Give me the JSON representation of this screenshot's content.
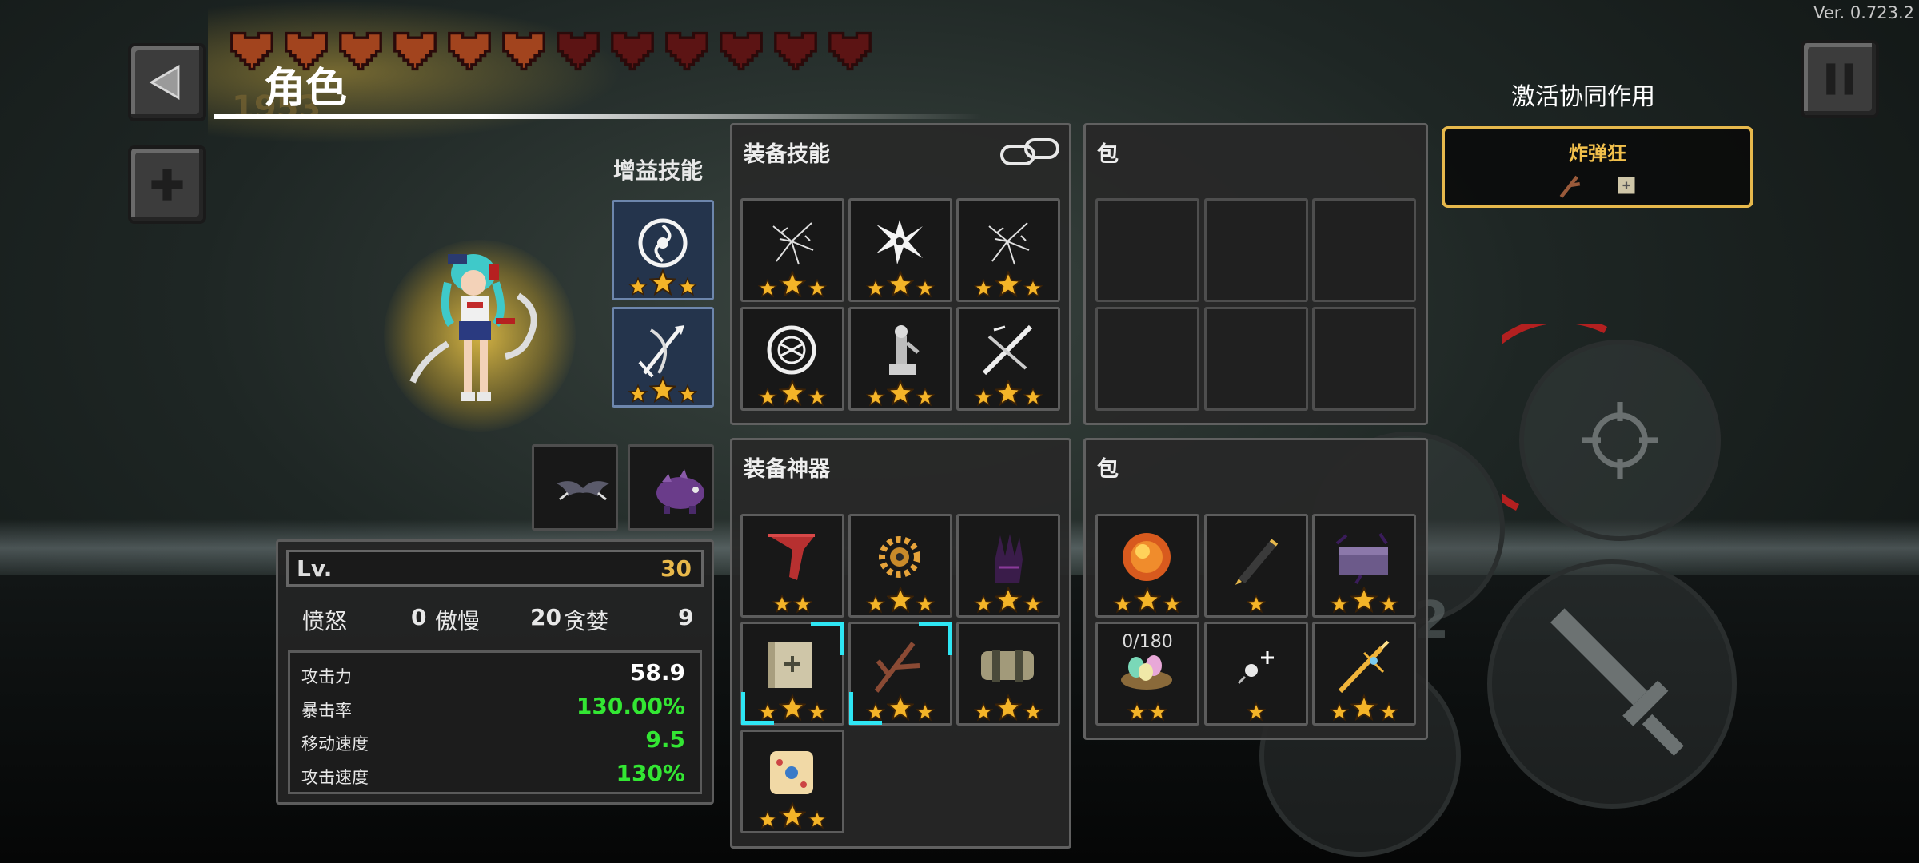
{
  "version": "Ver. 0.723.2",
  "title": "角色",
  "gold": "1953",
  "hearts": {
    "count": 12,
    "icon": "heart-icon"
  },
  "buff_skills": {
    "label": "增益技能",
    "items": [
      {
        "icon": "swirl-orb-icon",
        "stars": 3
      },
      {
        "icon": "bow-arrow-icon",
        "stars": 3
      }
    ]
  },
  "character": {
    "icon": "character-sprite-icon"
  },
  "companions": [
    {
      "icon": "bat-icon"
    },
    {
      "icon": "purple-boar-icon"
    }
  ],
  "equipped_skills": {
    "label": "装备技能",
    "link_icon": "chain-link-icon",
    "items": [
      {
        "icon": "shatter-icon",
        "stars": 3
      },
      {
        "icon": "shuriken-icon",
        "stars": 3
      },
      {
        "icon": "shatter-icon",
        "stars": 3
      },
      {
        "icon": "spiral-ring-icon",
        "stars": 3
      },
      {
        "icon": "statue-icon",
        "stars": 3
      },
      {
        "icon": "crossed-blades-icon",
        "stars": 3
      }
    ]
  },
  "skills_bag": {
    "label": "包",
    "slots": 6
  },
  "equipped_artifacts": {
    "label": "装备神器",
    "items": [
      {
        "icon": "red-scarf-icon",
        "stars": 2
      },
      {
        "icon": "golden-gear-icon",
        "stars": 3
      },
      {
        "icon": "dark-glove-icon",
        "stars": 3
      },
      {
        "icon": "scroll-icon",
        "stars": 3,
        "highlight": true
      },
      {
        "icon": "branch-icon",
        "stars": 3,
        "highlight": true
      },
      {
        "icon": "barrel-icon",
        "stars": 3
      },
      {
        "icon": "dice-icon",
        "stars": 3
      }
    ]
  },
  "artifacts_bag": {
    "label": "包",
    "items": [
      {
        "icon": "fire-orb-icon",
        "stars": 3
      },
      {
        "icon": "pen-icon",
        "stars": 1
      },
      {
        "icon": "purple-chest-icon",
        "stars": 3
      },
      {
        "icon": "egg-nest-icon",
        "stars": 2,
        "counter": "0/180"
      },
      {
        "icon": "sparkle-icon",
        "stars": 1
      },
      {
        "icon": "golden-sword-icon",
        "stars": 3
      }
    ]
  },
  "stats": {
    "level_label": "Lv.",
    "level": "30",
    "sins": [
      {
        "label": "愤怒",
        "value": "0"
      },
      {
        "label": "傲慢",
        "value": "20"
      },
      {
        "label": "贪婪",
        "value": "9"
      }
    ],
    "rows": [
      {
        "label": "攻击力",
        "value": "58.9",
        "color": "#ffffff"
      },
      {
        "label": "暴击率",
        "value": "130.00%",
        "color": "#33e633"
      },
      {
        "label": "移动速度",
        "value": "9.5",
        "color": "#33e633"
      },
      {
        "label": "攻击速度",
        "value": "130%",
        "color": "#33e633"
      }
    ]
  },
  "synergy": {
    "title": "激活协同作用",
    "name": "炸弹狂",
    "icons": [
      "branch-icon",
      "scroll-icon"
    ]
  },
  "controls": {
    "skill_counter": "2"
  },
  "colors": {
    "accent_gold": "#e6b84c",
    "stat_green": "#33e633",
    "highlight_cyan": "#2ee6f4"
  }
}
